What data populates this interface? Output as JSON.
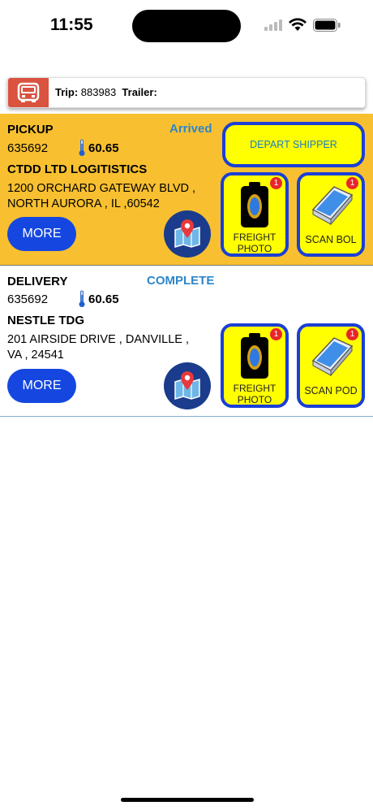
{
  "status_bar": {
    "time": "11:55"
  },
  "trip": {
    "trip_label": "Trip:",
    "trip_number": "883983",
    "trailer_label": "Trailer:",
    "trailer_value": ""
  },
  "pickup": {
    "title": "PICKUP",
    "status": "Arrived",
    "number": "635692",
    "temperature": "60.65",
    "company": "CTDD LTD LOGITISTICS",
    "address_line1": "1200 ORCHARD GATEWAY BLVD ,",
    "address_line2": "NORTH AURORA , IL ,60542",
    "more_label": "MORE",
    "depart_label": "DEPART SHIPPER",
    "freight_photo_label_1": "FREIGHT",
    "freight_photo_label_2": "PHOTO",
    "freight_photo_badge": "1",
    "scan_label": "SCAN BOL",
    "scan_badge": "1"
  },
  "delivery": {
    "title": "DELIVERY",
    "status": "COMPLETE",
    "number": "635692",
    "temperature": "60.65",
    "company": "NESTLE TDG",
    "address_line1": "201 AIRSIDE DRIVE , DANVILLE ,",
    "address_line2": "VA , 24541",
    "more_label": "MORE",
    "freight_photo_label_1": "FREIGHT",
    "freight_photo_label_2": "PHOTO",
    "freight_photo_badge": "1",
    "scan_label": "SCAN POD",
    "scan_badge": "1"
  },
  "colors": {
    "accent_blue": "#1547e0",
    "tile_yellow": "#ffff00",
    "pickup_bg": "#f8c030",
    "status_blue": "#2e86c8"
  }
}
